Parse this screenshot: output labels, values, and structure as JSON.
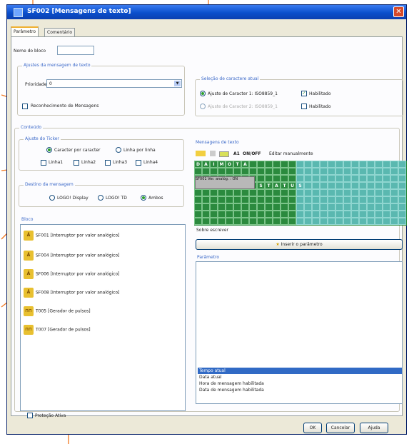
{
  "window": {
    "title": "SF002 [Mensagens de texto]",
    "close_glyph": "✕"
  },
  "tabs": [
    {
      "label": "Parâmetro"
    },
    {
      "label": "Comentário"
    }
  ],
  "block_name": {
    "label": "Nome do bloco",
    "value": ""
  },
  "message_settings": {
    "title": "Ajustes da mensagem de texto",
    "priority_label": "Prioridade",
    "priority_value": "0",
    "ack_label": "Reconhecimento de Mensagens"
  },
  "charset": {
    "title": "Seleção de caractere atual",
    "set1_label": "Ajuste de Caracter 1: ISO8859_1",
    "set1_enabled_label": "Habilitado",
    "set2_label": "Ajuste de Caracter 2: ISO8859_1",
    "set2_enabled_label": "Habilitado"
  },
  "content": {
    "title": "Conteúdo"
  },
  "ticker": {
    "title": "Ajuste do Ticker",
    "mode_char": "Caracter por caracter",
    "mode_line": "Linha por linha",
    "line1": "Linha1",
    "line2": "Linha2",
    "line3": "Linha3",
    "line4": "Linha4"
  },
  "destination": {
    "title": "Destino da mensagem",
    "opt1": "LOGO! Display",
    "opt2": "LOGO! TD",
    "opt3": "Ambos"
  },
  "blocks": {
    "title": "Bloco",
    "items": [
      {
        "icon": "analog-switch-icon",
        "glyph": "Ā",
        "label": "SF001 [Interruptor por valor analógico]"
      },
      {
        "icon": "analog-switch-icon",
        "glyph": "Ā",
        "label": "SF004 [Interruptor por valor analógico]"
      },
      {
        "icon": "analog-switch-icon",
        "glyph": "Ā",
        "label": "SF006 [Interruptor por valor analógico]"
      },
      {
        "icon": "analog-switch-icon",
        "glyph": "Ā",
        "label": "SF008 [Interruptor por valor analógico]"
      },
      {
        "icon": "pulse-generator-icon",
        "glyph": "⊓⊓",
        "label": "T005 [Gerador de pulsos]"
      },
      {
        "icon": "pulse-generator-icon",
        "glyph": "⊓⊓",
        "label": "T007 [Gerador de pulsos]"
      }
    ]
  },
  "text_messages": {
    "title": "Mensagens de texto",
    "toolbar": {
      "font_label": "A1",
      "onoff_label": "ON/OFF",
      "manual_edit_label": "Editar manualmente"
    },
    "row1_text": "DAIMOTA",
    "row2_text": "STATUS",
    "inserted_block": "SF001 Ver. analóg. : ON",
    "overwrite_label": "Sobre escrever",
    "insert_button": "Inserir o parâmetro"
  },
  "parameters": {
    "title": "Parâmetro",
    "items": [
      "Tempo atual",
      "Data atual",
      "Hora de mensagem habilitada",
      "Data de mensagem habilitada"
    ],
    "selected_index": 0
  },
  "protection": {
    "label": "Proteção Ativa"
  },
  "buttons": {
    "ok": "OK",
    "cancel": "Cancelar",
    "help": "Ajuda"
  },
  "colors": {
    "accent": "#0a4fcc",
    "grid_green": "#2b8a3e",
    "grid_teal": "#5ab8b0",
    "selection": "#316ac5",
    "annotation": "#f07820"
  }
}
